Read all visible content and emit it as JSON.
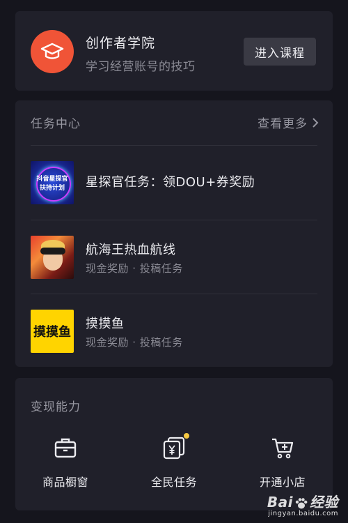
{
  "academy": {
    "title": "创作者学院",
    "subtitle": "学习经营账号的技巧",
    "button_label": "进入课程",
    "icon": "graduation-cap-icon",
    "logo_color": "#f05437"
  },
  "tasks": {
    "section_title": "任务中心",
    "see_more_label": "查看更多",
    "items": [
      {
        "title": "星探官任务：领DOU+券奖励",
        "subtitle": "",
        "thumb_line1": "抖音星探官",
        "thumb_line2": "扶持计划"
      },
      {
        "title": "航海王热血航线",
        "subtitle": "现金奖励 · 投稿任务"
      },
      {
        "title": "摸摸鱼",
        "subtitle": "现金奖励 · 投稿任务",
        "thumb_text": "摸摸鱼"
      }
    ]
  },
  "monetize": {
    "section_title": "变现能力",
    "features": [
      {
        "label": "商品橱窗",
        "icon": "briefcase-icon"
      },
      {
        "label": "全民任务",
        "icon": "yuan-task-icon",
        "badge": true
      },
      {
        "label": "开通小店",
        "icon": "shopping-cart-icon"
      }
    ]
  },
  "watermark": {
    "brand": "Bai",
    "brand_suffix": "经验",
    "url": "jingyan.baidu.com"
  },
  "colors": {
    "background": "#15151d",
    "card": "#20202a",
    "accent_orange": "#f05437",
    "badge_yellow": "#f5c842"
  }
}
